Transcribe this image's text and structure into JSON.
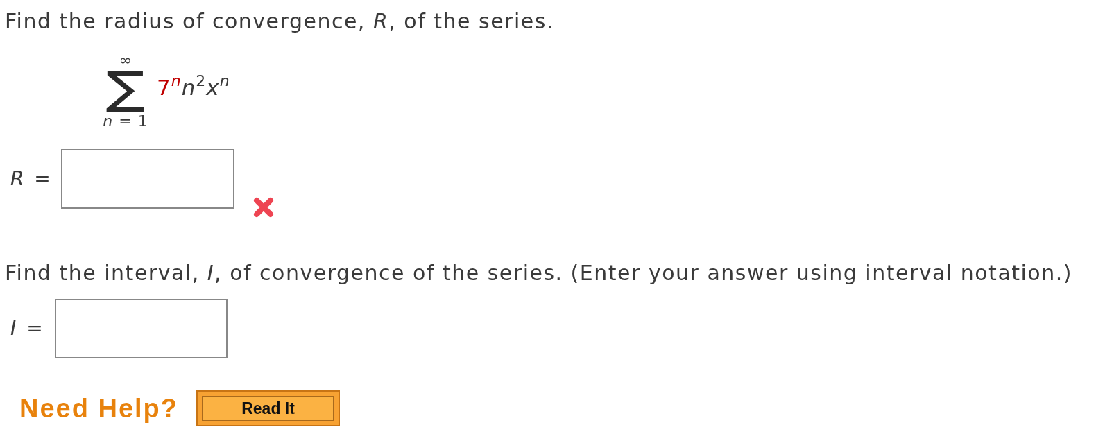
{
  "questions": [
    {
      "prompt": "Find the radius of convergence, *R*, of the series.",
      "series": {
        "upper": "∞",
        "operator": "∑",
        "lower": "*n* = 1",
        "factors": [
          {
            "base": "7",
            "exponent": "*n*",
            "highlighted": true
          },
          {
            "base": "*n*",
            "exponent": "2",
            "highlighted": false
          },
          {
            "base": "*x*",
            "exponent": "*n*",
            "highlighted": false
          }
        ]
      },
      "answer": {
        "label": "*R* =",
        "marked_wrong": true
      }
    },
    {
      "prompt": "Find the interval, *I*, of convergence of the series. (Enter your answer using interval notation.)",
      "answer": {
        "label": "*I* =",
        "marked_wrong": false
      }
    }
  ],
  "help": {
    "label": "Need Help?",
    "buttons": [
      "Read It"
    ]
  }
}
